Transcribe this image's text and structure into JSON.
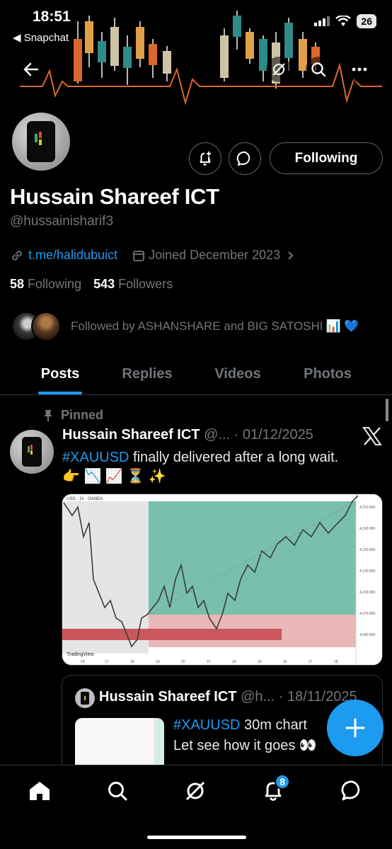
{
  "status_bar": {
    "time": "18:51",
    "back_app": "◀ Snapchat",
    "battery": "26",
    "icons": [
      "signal-icon",
      "wifi-icon",
      "battery-icon"
    ]
  },
  "header": {
    "back_icon": "back-arrow-icon",
    "grok_icon": "grok-icon",
    "search_icon": "search-icon",
    "more_icon": "more-icon"
  },
  "profile": {
    "name": "Hussain Shareef ICT",
    "handle": "@hussainisharif3",
    "link": "t.me/halidubuict",
    "joined": "Joined December 2023",
    "following_count": "58",
    "following_label": "Following",
    "followers_count": "543",
    "followers_label": "Followers",
    "followed_by": "Followed by ASHANSHARE and BIG SATOSHI",
    "followed_by_emojis": "📊 💙",
    "follow_button": "Following"
  },
  "tabs": [
    {
      "label": "Posts",
      "active": true
    },
    {
      "label": "Replies",
      "active": false
    },
    {
      "label": "Videos",
      "active": false
    },
    {
      "label": "Photos",
      "active": false
    }
  ],
  "post": {
    "pinned_label": "Pinned",
    "author_name": "Hussain Shareef ICT",
    "author_meta": "@... · 01/12/2025",
    "hashtag": "#XAUUSD",
    "text": " finally delivered after a long wait.",
    "emojis": "👉 📉 📈 ⏳ ✨"
  },
  "quote": {
    "author_name": "Hussain Shareef ICT",
    "author_meta": "@h... · 18/11/2025",
    "hashtag": "#XAUUSD",
    "line1": " 30m chart",
    "line2": "Let see how it goes 👀"
  },
  "bottom_nav": {
    "items": [
      "home-icon",
      "search-icon",
      "grok-icon",
      "notifications-icon",
      "messages-icon"
    ],
    "notification_badge": "8"
  },
  "colors": {
    "accent": "#1d9bf0",
    "muted": "#71767b",
    "background": "#000000",
    "border": "#2f3336"
  }
}
